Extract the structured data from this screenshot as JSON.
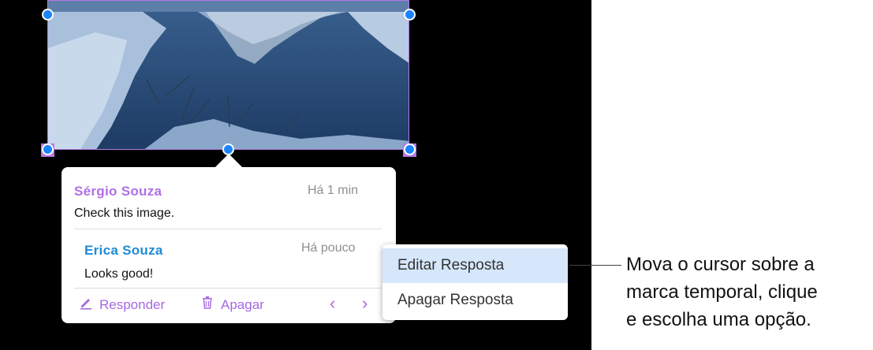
{
  "comments": [
    {
      "author": "Sérgio Souza",
      "author_color": "#b06fe6",
      "time": "Há 1 min",
      "text": "Check this image."
    },
    {
      "author": "Erica Souza",
      "author_color": "#1e8bd6",
      "time": "Há pouco",
      "text": "Looks good!"
    }
  ],
  "actions": {
    "reply": "Responder",
    "delete": "Apagar",
    "prev_icon": "chevron-left-icon",
    "next_icon": "chevron-right-icon"
  },
  "context_menu": {
    "items": [
      "Editar Resposta",
      "Apagar Resposta"
    ],
    "highlighted_index": 0
  },
  "callout": {
    "lines": [
      "Mova o cursor sobre a",
      "marca temporal, clique",
      "e escolha uma opção."
    ]
  },
  "colors": {
    "accent": "#a56ae0",
    "handle": "#1a84ff",
    "selection_border": "#b679e8"
  }
}
